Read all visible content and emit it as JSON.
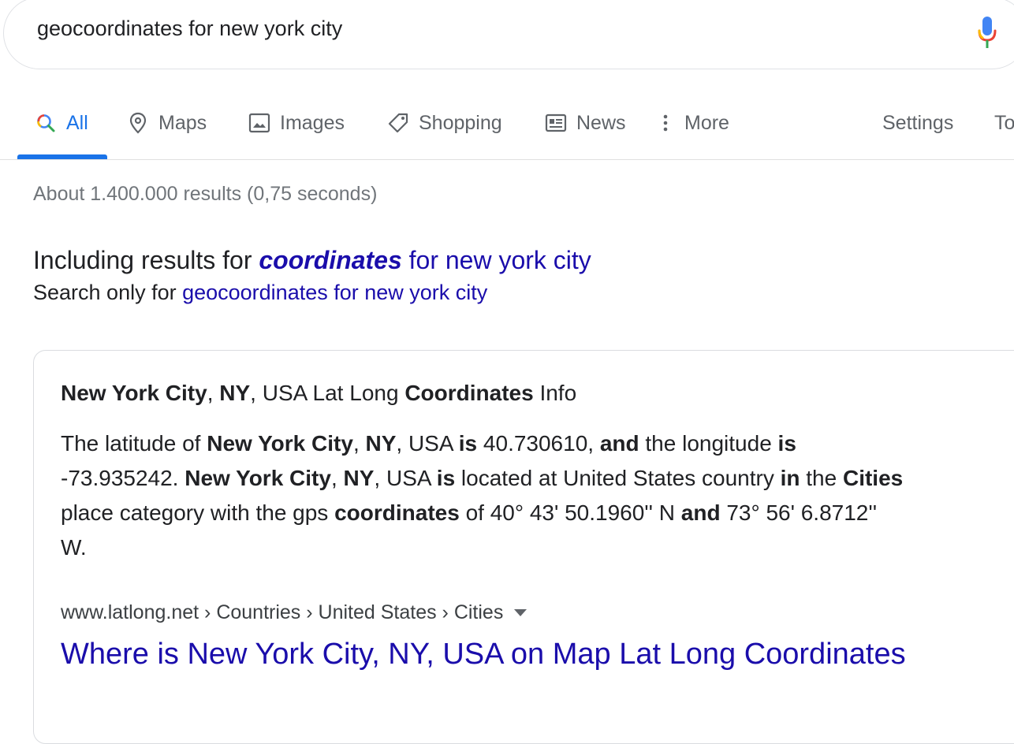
{
  "search": {
    "query": "geocoordinates for new york city"
  },
  "tabs": [
    {
      "label": "All",
      "icon": "search-icon"
    },
    {
      "label": "Maps",
      "icon": "map-pin-icon"
    },
    {
      "label": "Images",
      "icon": "image-icon"
    },
    {
      "label": "Shopping",
      "icon": "tag-icon"
    },
    {
      "label": "News",
      "icon": "newspaper-icon"
    },
    {
      "label": "More",
      "icon": "more-vertical-icon"
    }
  ],
  "tools": {
    "settings": "Settings",
    "tools": "To"
  },
  "result_stats": "About 1.400.000 results (0,75 seconds)",
  "spelling": {
    "including_prefix": "Including results for ",
    "corrected_word": "coordinates",
    "corrected_rest": " for new york city",
    "search_only_prefix": "Search only for ",
    "original_query": "geocoordinates for new york city"
  },
  "featured_snippet": {
    "title_parts": [
      {
        "t": "New York City",
        "b": true
      },
      {
        "t": ", ",
        "b": false
      },
      {
        "t": "NY",
        "b": true
      },
      {
        "t": ", USA Lat Long ",
        "b": false
      },
      {
        "t": "Coordinates",
        "b": true
      },
      {
        "t": " Info",
        "b": false
      }
    ],
    "lines": [
      [
        {
          "t": "The latitude of ",
          "b": false
        },
        {
          "t": "New York City",
          "b": true
        },
        {
          "t": ", ",
          "b": false
        },
        {
          "t": "NY",
          "b": true
        },
        {
          "t": ", USA ",
          "b": false
        },
        {
          "t": "is",
          "b": true
        },
        {
          "t": " 40.730610, ",
          "b": false
        },
        {
          "t": "and",
          "b": true
        },
        {
          "t": " the longitude ",
          "b": false
        },
        {
          "t": "is",
          "b": true
        }
      ],
      [
        {
          "t": "-73.935242. ",
          "b": false
        },
        {
          "t": "New York City",
          "b": true
        },
        {
          "t": ", ",
          "b": false
        },
        {
          "t": "NY",
          "b": true
        },
        {
          "t": ", USA ",
          "b": false
        },
        {
          "t": "is",
          "b": true
        },
        {
          "t": " located at United States country ",
          "b": false
        },
        {
          "t": "in",
          "b": true
        },
        {
          "t": " the ",
          "b": false
        },
        {
          "t": "Cities",
          "b": true
        }
      ],
      [
        {
          "t": "place category with the gps ",
          "b": false
        },
        {
          "t": "coordinates",
          "b": true
        },
        {
          "t": " of 40° 43' 50.1960'' N ",
          "b": false
        },
        {
          "t": "and",
          "b": true
        },
        {
          "t": " 73° 56' 6.8712''",
          "b": false
        }
      ],
      [
        {
          "t": "W.",
          "b": false
        }
      ]
    ],
    "breadcrumb": "www.latlong.net › Countries › United States › Cities",
    "result_title": "Where is New York City, NY, USA on Map Lat Long Coordinates"
  },
  "colors": {
    "accent": "#1a73e8",
    "link": "#1a0dab",
    "muted": "#70757a"
  }
}
